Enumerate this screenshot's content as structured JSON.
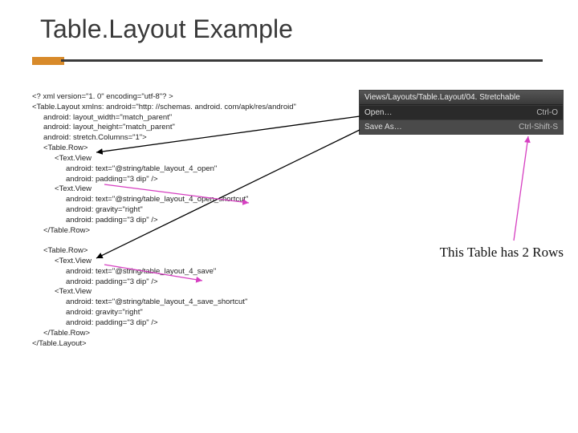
{
  "title": "Table.Layout Example",
  "code_lines": [
    {
      "text": "<? xml version=\"1. 0\" encoding=\"utf-8\"? >",
      "indent": 0
    },
    {
      "text": "<Table.Layout xmlns: android=\"http: //schemas. android. com/apk/res/android\"",
      "indent": 0
    },
    {
      "text": "android: layout_width=\"match_parent\"",
      "indent": 1
    },
    {
      "text": "android: layout_height=\"match_parent\"",
      "indent": 1
    },
    {
      "text": "android: stretch.Columns=\"1\">",
      "indent": 1
    },
    {
      "text": "<Table.Row>",
      "indent": 1
    },
    {
      "text": "<Text.View",
      "indent": 2
    },
    {
      "text": "android: text=\"@string/table_layout_4_open\"",
      "indent": 3
    },
    {
      "text": "android: padding=\"3 dip\" />",
      "indent": 3
    },
    {
      "text": "<Text.View",
      "indent": 2
    },
    {
      "text": "android: text=\"@string/table_layout_4_open_shortcut\"",
      "indent": 3
    },
    {
      "text": "android: gravity=\"right\"",
      "indent": 3
    },
    {
      "text": "android: padding=\"3 dip\" />",
      "indent": 3
    },
    {
      "text": "</Table.Row>",
      "indent": 1
    },
    {
      "text": "",
      "indent": 0
    },
    {
      "text": "<Table.Row>",
      "indent": 1
    },
    {
      "text": "<Text.View",
      "indent": 2
    },
    {
      "text": "android: text=\"@string/table_layout_4_save\"",
      "indent": 3
    },
    {
      "text": "android: padding=\"3 dip\" />",
      "indent": 3
    },
    {
      "text": "<Text.View",
      "indent": 2
    },
    {
      "text": "android: text=\"@string/table_layout_4_save_shortcut\"",
      "indent": 3
    },
    {
      "text": "android: gravity=\"right\"",
      "indent": 3
    },
    {
      "text": "android: padding=\"3 dip\" />",
      "indent": 3
    },
    {
      "text": "</Table.Row>",
      "indent": 1
    },
    {
      "text": "</Table.Layout>",
      "indent": 0
    }
  ],
  "dialog": {
    "header": "Views/Layouts/Table.Layout/04. Stretchable",
    "rows": [
      {
        "label": "Open…",
        "shortcut": "Ctrl-O"
      },
      {
        "label": "Save As…",
        "shortcut": "Ctrl-Shift-S"
      }
    ]
  },
  "callout": "This Table has 2 Rows",
  "colors": {
    "accent": "#d88a2a",
    "arrow_magenta": "#d63fc1",
    "arrow_black": "#000000"
  }
}
